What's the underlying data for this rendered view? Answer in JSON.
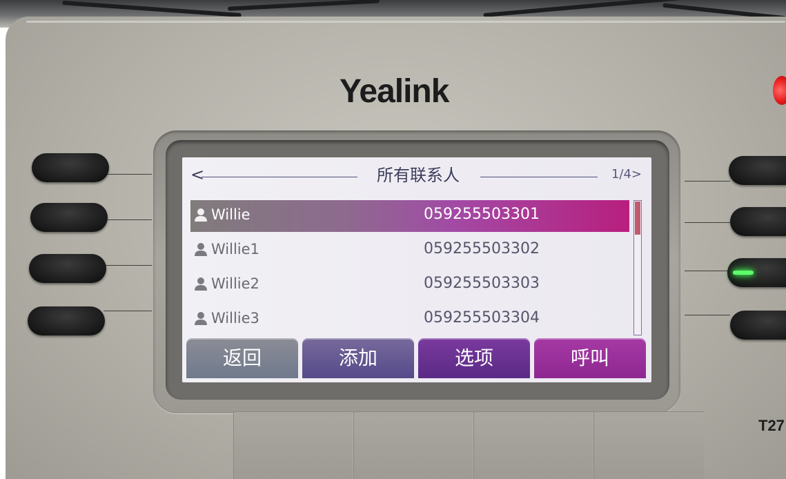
{
  "device": {
    "brand": "Yealink",
    "model": "T27"
  },
  "screen": {
    "title": "所有联系人",
    "back_glyph": "<",
    "page_indicator": "1/4>",
    "contacts": [
      {
        "name": "Willie",
        "number": "059255503301",
        "selected": true
      },
      {
        "name": "Willie1",
        "number": "059255503302",
        "selected": false
      },
      {
        "name": "Willie2",
        "number": "059255503303",
        "selected": false
      },
      {
        "name": "Willie3",
        "number": "059255503304",
        "selected": false
      }
    ],
    "softkeys": [
      "返回",
      "添加",
      "选项",
      "呼叫"
    ]
  },
  "icons": {
    "contact": "person-icon"
  },
  "colors": {
    "selection_start": "#807c7c",
    "selection_end": "#b81f7e",
    "line_key_led": "#5cff6a",
    "power_led": "#e81b1b"
  }
}
